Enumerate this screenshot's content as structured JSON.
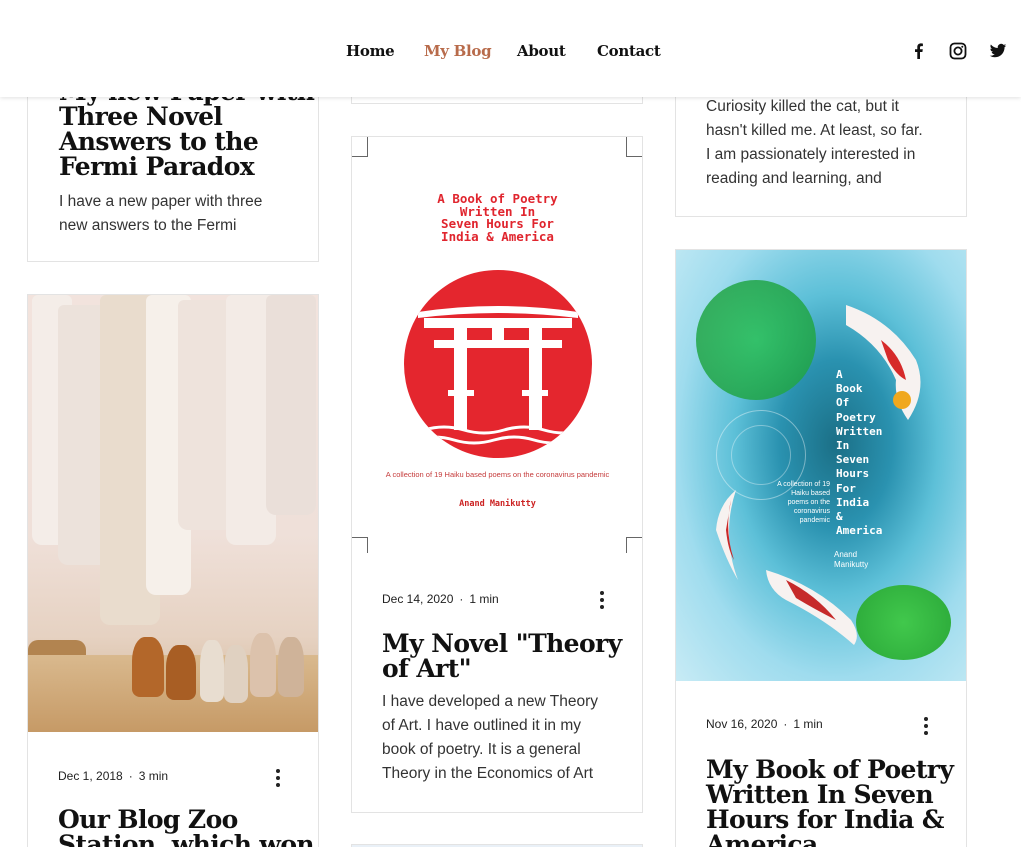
{
  "nav": {
    "items": [
      {
        "label": "Home",
        "active": false
      },
      {
        "label": "My Blog",
        "active": true
      },
      {
        "label": "About",
        "active": false
      },
      {
        "label": "Contact",
        "active": false
      }
    ],
    "social_icons": [
      "facebook-icon",
      "instagram-icon",
      "twitter-icon"
    ]
  },
  "posts": {
    "fermi": {
      "title_lines": [
        "My new Paper with",
        "Three Novel",
        "Answers to the",
        "Fermi Paradox"
      ],
      "excerpt_lines": [
        "I have a new paper with three",
        "new answers to the Fermi"
      ]
    },
    "zoo": {
      "date": "Dec 1, 2018",
      "read_time": "3 min",
      "title_lines": [
        "Our Blog Zoo",
        "Station, which won"
      ]
    },
    "theory": {
      "date": "Dec 14, 2020",
      "read_time": "1 min",
      "title_lines": [
        "My Novel \"Theory",
        "of Art\""
      ],
      "excerpt_lines": [
        "I have developed a new Theory",
        "of Art. I have outlined it in my",
        "book of poetry. It is a general",
        "Theory in the Economics of Art"
      ],
      "cover": {
        "title_lines": [
          "A Book of Poetry",
          "Written In",
          "Seven Hours For",
          "India & America"
        ],
        "subtitle": "A collection of 19 Haiku based poems on the coronavirus pandemic",
        "author": "Anand Manikutty"
      }
    },
    "about": {
      "excerpt_lines": [
        "Curiosity killed the cat, but it",
        "hasn't killed me. At least, so far.",
        "I am passionately interested in",
        "reading and learning, and"
      ]
    },
    "poetry": {
      "date": "Nov 16, 2020",
      "read_time": "1 min",
      "title_lines": [
        "My Book of Poetry",
        "Written In Seven",
        "Hours for India &",
        "America"
      ],
      "cover": {
        "title": "A\nBook\nOf\nPoetry\nWritten\nIn\nSeven\nHours\nFor\nIndia\n&\nAmerica",
        "subtitle": "A collection of 19 Haiku based poems on the coronavirus pandemic",
        "author_lines": [
          "Anand",
          "Manikutty"
        ]
      }
    }
  },
  "colors": {
    "accent": "#b86b4b",
    "torii_red": "#e4262e"
  }
}
